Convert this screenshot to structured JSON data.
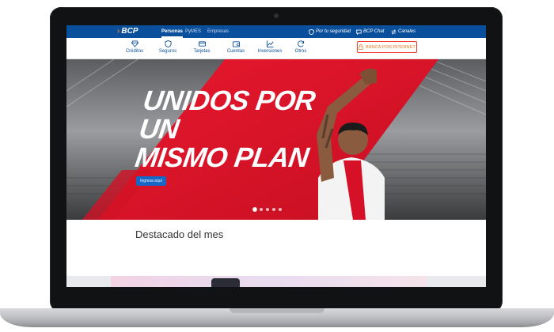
{
  "site": {
    "logo": "BCP",
    "logo_chevron": "›",
    "segments": [
      "Personas",
      "PyMES",
      "Empresas"
    ],
    "active_segment": "Personas",
    "utility_links": [
      {
        "label": "Por tu seguridad",
        "icon": "shield-icon"
      },
      {
        "label": "BCP Chat",
        "icon": "chat-icon"
      },
      {
        "label": "Canales",
        "icon": "swap-icon"
      }
    ]
  },
  "nav": {
    "items": [
      {
        "label": "Créditos",
        "icon": "diamond-icon"
      },
      {
        "label": "Seguros",
        "icon": "shield-icon"
      },
      {
        "label": "Tarjetas",
        "icon": "card-icon"
      },
      {
        "label": "Cuentas",
        "icon": "wallet-icon"
      },
      {
        "label": "Inversiones",
        "icon": "chart-icon"
      },
      {
        "label": "Otros",
        "icon": "refresh-icon"
      }
    ],
    "banca_label": "BANCA POR INTERNET"
  },
  "hero": {
    "line1": "UNIDOS POR UN",
    "line2": "MISMO PLAN",
    "cta_label": "Ingresa aquí",
    "slides": 5,
    "active_slide": 0
  },
  "featured": {
    "title": "Destacado del mes"
  },
  "colors": {
    "brand_blue": "#0a4f9c",
    "accent_orange": "#f47920",
    "hero_red": "#e3172d"
  }
}
